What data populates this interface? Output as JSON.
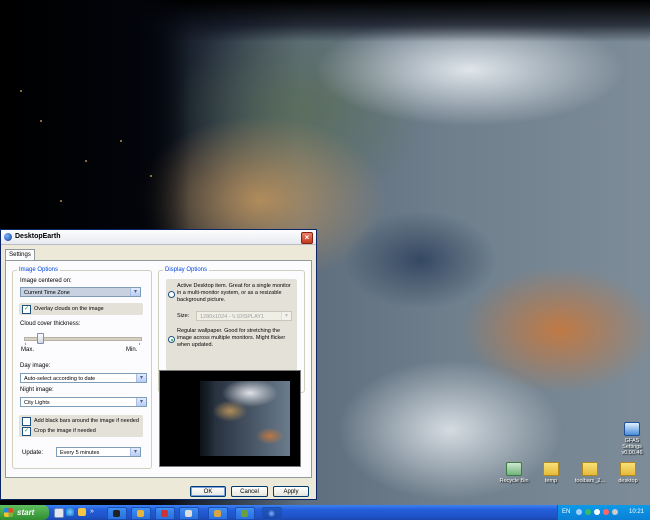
{
  "window": {
    "title": "DesktopEarth",
    "tab_settings": "Settings",
    "image_options": {
      "legend": "Image Options",
      "centered_label": "Image centered on:",
      "centered_value": "Current Time Zone",
      "overlay_clouds": "Overlay clouds on the image",
      "overlay_clouds_checked": true,
      "cloud_thickness_label": "Cloud cover thickness:",
      "cloud_thickness_level": 0.12,
      "slider_max": "Max.",
      "slider_min": "Min.",
      "day_image_label": "Day image:",
      "day_image_value": "Auto-select according to date",
      "night_image_label": "Night image:",
      "night_image_value": "City Lights",
      "add_black_bars": "Add black bars around the image if needed",
      "add_black_bars_checked": false,
      "crop_image": "Crop the image if needed",
      "crop_image_checked": true,
      "update_label": "Update:",
      "update_value": "Every 5 minutes"
    },
    "display_options": {
      "legend": "Display Options",
      "active_desktop_text": "Active Desktop item. Great for a single monitor in a multi-monitor system, or as a resizable background picture.",
      "size_label": "Size:",
      "size_value": "1280x1024 - \\\\.\\DISPLAY1",
      "regular_wallpaper_text": "Regular wallpaper. Good for stretching the image across multiple monitors. Might flicker when updated.",
      "selected_mode": "regular_wallpaper"
    },
    "buttons": {
      "ok": "OK",
      "cancel": "Cancel",
      "apply": "Apply"
    }
  },
  "desktop_icons": [
    {
      "label": "Recycle Bin",
      "icon": "recycle-bin-icon"
    },
    {
      "label": "temp",
      "icon": "folder-icon"
    },
    {
      "label": "toolbars_2...",
      "icon": "folder-icon"
    },
    {
      "label": "desktop",
      "icon": "folder-icon"
    },
    {
      "label": "GFAS Settings v0.00.46",
      "icon": "settings-app-icon"
    }
  ],
  "taskbar": {
    "start_label": "start",
    "language": "EN",
    "clock": "10:21"
  }
}
